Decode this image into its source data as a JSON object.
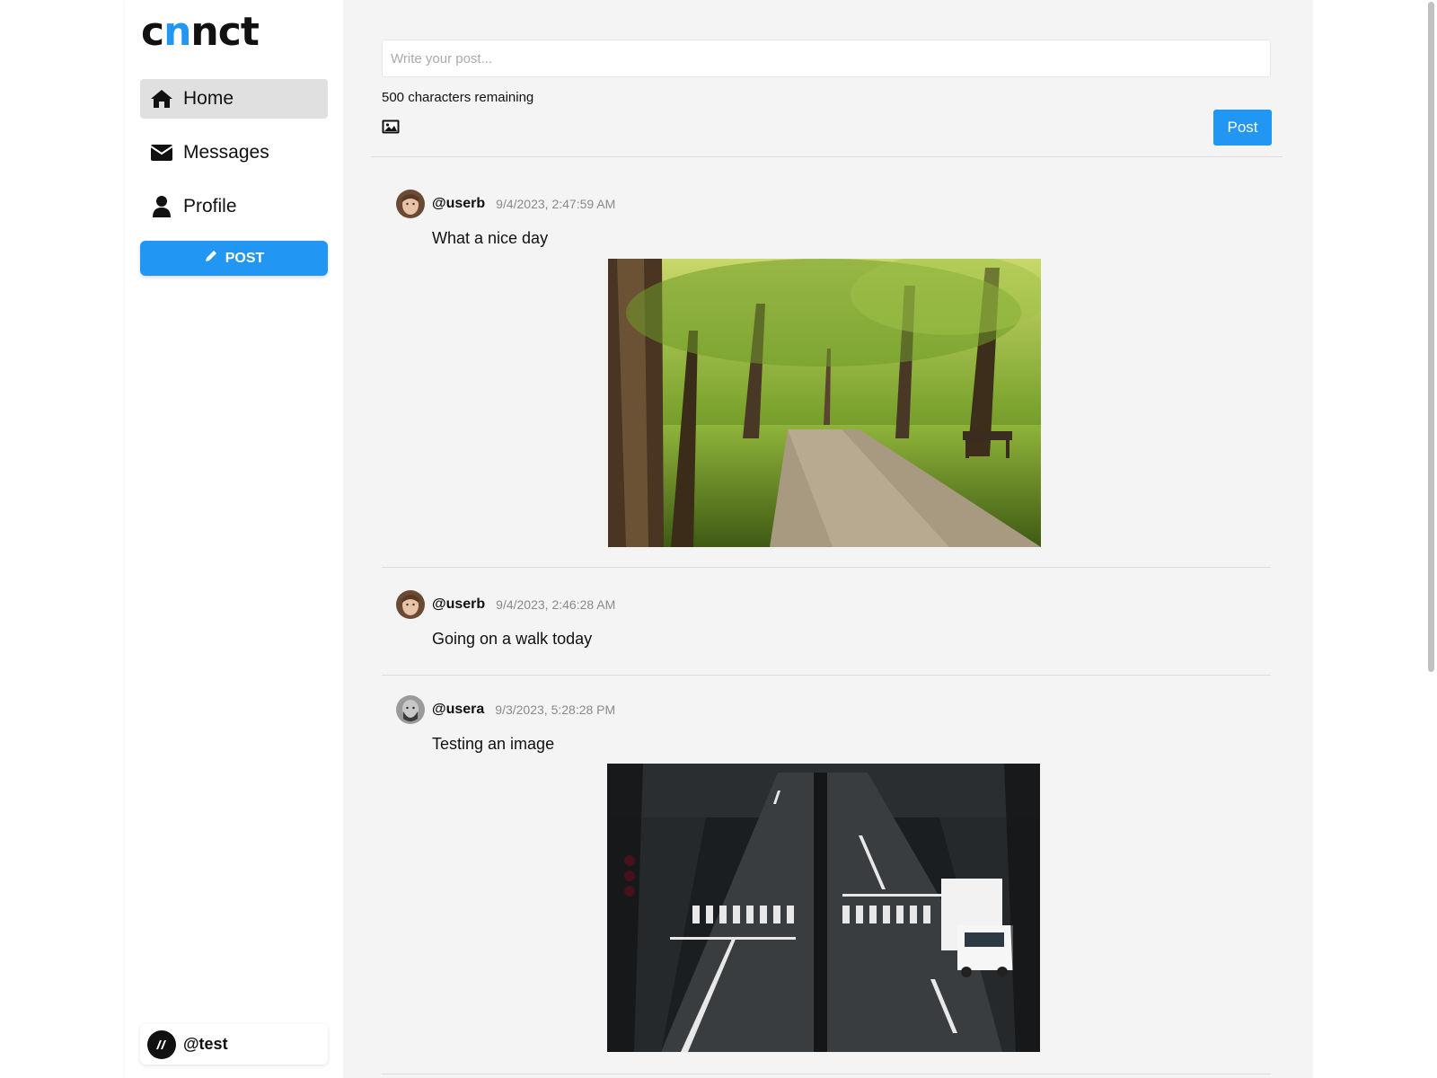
{
  "brand": {
    "logo_prefix": "c",
    "logo_accent": "n",
    "logo_suffix": "nct"
  },
  "sidebar": {
    "items": [
      {
        "label": "Home",
        "icon": "home-icon"
      },
      {
        "label": "Messages",
        "icon": "envelope-icon"
      },
      {
        "label": "Profile",
        "icon": "user-icon"
      }
    ],
    "post_button_label": "POST",
    "current_user": "@test"
  },
  "composer": {
    "placeholder": "Write your post...",
    "chars_remaining": "500 characters remaining",
    "submit_label": "Post"
  },
  "posts": [
    {
      "user": "@userb",
      "time": "9/4/2023, 2:47:59 AM",
      "text": "What a nice day",
      "image": "park-tree-path-photo"
    },
    {
      "user": "@userb",
      "time": "9/4/2023, 2:46:28 AM",
      "text": "Going on a walk today"
    },
    {
      "user": "@usera",
      "time": "9/3/2023, 5:28:28 PM",
      "text": "Testing an image",
      "image": "city-street-crosswalk-truck-photo"
    }
  ],
  "colors": {
    "accent": "#2196f3",
    "active_nav": "#e0e0e0",
    "feed_bg": "#f4f4f4"
  }
}
